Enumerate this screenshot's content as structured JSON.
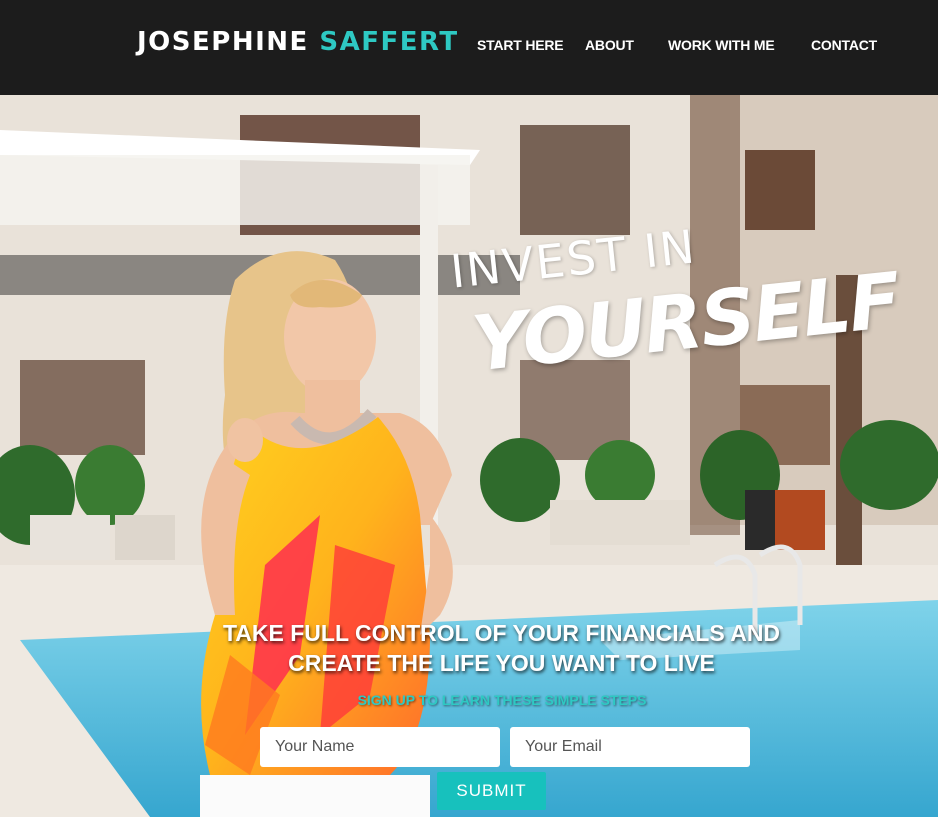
{
  "brand": {
    "first": "JOSEPHINE",
    "last": "SAFFERT"
  },
  "nav": {
    "items": [
      {
        "label": "START HERE"
      },
      {
        "label": "ABOUT"
      },
      {
        "label": "WORK WITH ME"
      },
      {
        "label": "CONTACT"
      }
    ]
  },
  "hero": {
    "headline_top": "INVEST IN",
    "headline_bottom": "YOURSELF",
    "tagline_line1": "TAKE FULL CONTROL OF YOUR FINANCIALS AND",
    "tagline_line2": "CREATE THE LIFE YOU WANT TO LIVE",
    "signup_note": "SIGN UP TO LEARN THESE SIMPLE STEPS"
  },
  "form": {
    "name_placeholder": "Your Name",
    "email_placeholder": "Your Email",
    "submit_label": "SUBMIT"
  },
  "colors": {
    "accent": "#2ec9c3",
    "button": "#17c1bd",
    "header_bg": "#1c1c1c"
  }
}
